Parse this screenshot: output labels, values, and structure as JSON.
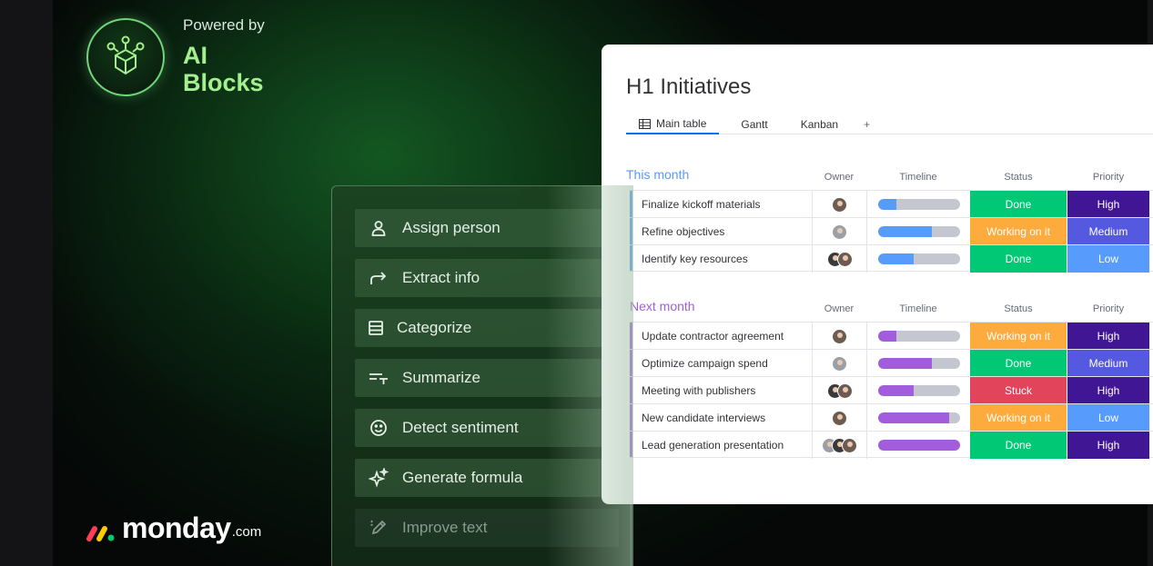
{
  "branding": {
    "powered_by": "Powered by",
    "ai_line1": "AI",
    "ai_line2": "Blocks",
    "logo_word": "monday",
    "logo_suffix": ".com",
    "logo_colors": [
      "#ff3d57",
      "#ffcb00",
      "#00ca72"
    ]
  },
  "ai_menu": {
    "items": [
      {
        "label": "Assign person",
        "icon": "person-icon"
      },
      {
        "label": "Extract info",
        "icon": "redirect-arrow-icon"
      },
      {
        "label": "Categorize",
        "icon": "list-icon"
      },
      {
        "label": "Summarize",
        "icon": "summarize-icon"
      },
      {
        "label": "Detect sentiment",
        "icon": "smiley-icon"
      },
      {
        "label": "Generate formula",
        "icon": "sparkle-icon"
      },
      {
        "label": "Improve text",
        "icon": "pen-icon"
      }
    ]
  },
  "board": {
    "title": "H1 Initiatives",
    "tabs": [
      {
        "label": "Main table",
        "active": true
      },
      {
        "label": "Gantt"
      },
      {
        "label": "Kanban"
      },
      {
        "label": "+"
      }
    ],
    "columns": {
      "owner": "Owner",
      "timeline": "Timeline",
      "status": "Status",
      "priority": "Priority"
    },
    "groups": [
      {
        "title": "This month",
        "color": "#579bfc",
        "timeline_color": "#579bfc",
        "rows": [
          {
            "name": "Finalize kickoff materials",
            "owners": 1,
            "progress": 0.22,
            "status": "Done",
            "priority": "High"
          },
          {
            "name": "Refine objectives",
            "owners": 1,
            "progress": 0.65,
            "status": "Working on it",
            "priority": "Medium"
          },
          {
            "name": "Identify key resources",
            "owners": 2,
            "progress": 0.43,
            "status": "Done",
            "priority": "Low"
          }
        ]
      },
      {
        "title": "Next month",
        "color": "#a25ddc",
        "timeline_color": "#a25ddc",
        "rows": [
          {
            "name": "Update contractor agreement",
            "owners": 1,
            "progress": 0.22,
            "status": "Working on it",
            "priority": "High"
          },
          {
            "name": "Optimize campaign spend",
            "owners": 1,
            "progress": 0.65,
            "status": "Done",
            "priority": "Medium"
          },
          {
            "name": "Meeting with publishers",
            "owners": 2,
            "progress": 0.43,
            "status": "Stuck",
            "priority": "High"
          },
          {
            "name": "New candidate interviews",
            "owners": 1,
            "progress": 0.87,
            "status": "Working on it",
            "priority": "Low"
          },
          {
            "name": "Lead generation presentation",
            "owners": 3,
            "progress": 1.0,
            "status": "Done",
            "priority": "High"
          }
        ]
      }
    ],
    "status_colors": {
      "Done": "#00c875",
      "Working on it": "#fdab3d",
      "Stuck": "#e2445c"
    },
    "priority_colors": {
      "High": "#401694",
      "Medium": "#5559df",
      "Low": "#579bfc"
    }
  }
}
